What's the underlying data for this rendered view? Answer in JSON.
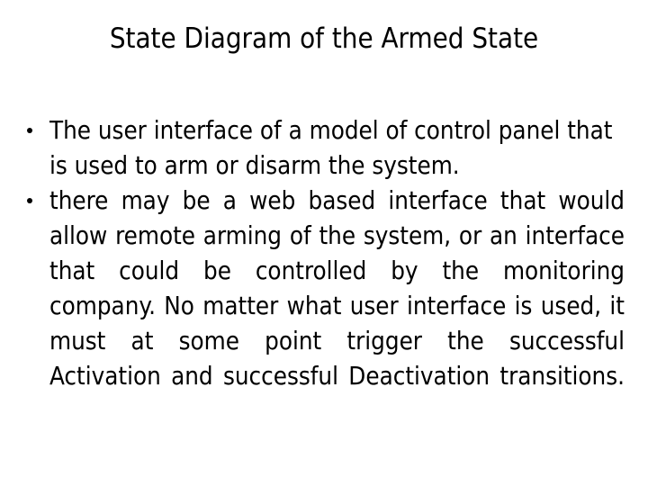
{
  "slide": {
    "title": "State Diagram of the Armed State",
    "background_color": "#ffffff",
    "text_color": "#000000",
    "bullets": [
      {
        "marker": "bullet-dot",
        "text": "The user interface of a model of control panel that is used to arm or disarm the system.",
        "alignment": "left"
      },
      {
        "marker": "bullet-dot",
        "text": "there may be a web based interface that would allow remote arming of the system, or an interface that could be controlled by the monitoring company. No matter what user interface is used, it must at some point trigger the successful Activation and successful Deactivation transitions.",
        "alignment": "justify"
      }
    ]
  }
}
